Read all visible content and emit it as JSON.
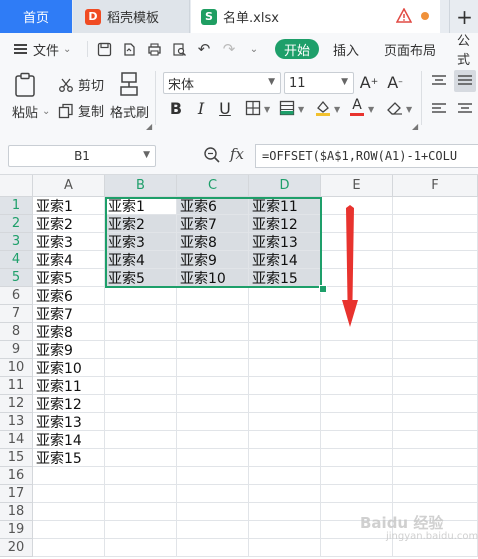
{
  "tabs": {
    "home": "首页",
    "docer": "稻壳模板",
    "docer_icon": "D",
    "file": "名单.xlsx",
    "file_icon": "S",
    "add": "+"
  },
  "menu": {
    "file_label": "文件",
    "start": "开始",
    "insert": "插入",
    "page_layout": "页面布局",
    "formula": "公式"
  },
  "ribbon": {
    "paste": "粘贴",
    "cut": "剪切",
    "copy": "复制",
    "format_painter": "格式刷",
    "font_name": "宋体",
    "font_size": "11",
    "bold": "B",
    "italic": "I",
    "underline": "U"
  },
  "formula_bar": {
    "name_box": "B1",
    "fx": "fx",
    "formula": "=OFFSET($A$1,ROW(A1)-1+COLU"
  },
  "columns": [
    "A",
    "B",
    "C",
    "D",
    "E",
    "F"
  ],
  "rows": [
    "1",
    "2",
    "3",
    "4",
    "5",
    "6",
    "7",
    "8",
    "9",
    "10",
    "11",
    "12",
    "13",
    "14",
    "15",
    "16",
    "17",
    "18",
    "19",
    "20"
  ],
  "cells": {
    "A": [
      "亚索1",
      "亚索2",
      "亚索3",
      "亚索4",
      "亚索5",
      "亚索6",
      "亚索7",
      "亚索8",
      "亚索9",
      "亚索10",
      "亚索11",
      "亚索12",
      "亚索13",
      "亚索14",
      "亚索15"
    ],
    "B": [
      "亚索1",
      "亚索2",
      "亚索3",
      "亚索4",
      "亚索5"
    ],
    "C": [
      "亚索6",
      "亚索7",
      "亚索8",
      "亚索9",
      "亚索10"
    ],
    "D": [
      "亚索11",
      "亚索12",
      "亚索13",
      "亚索14",
      "亚索15"
    ]
  },
  "watermark": "Baidu 经验",
  "watermark_sub": "jingyan.baidu.com",
  "colors": {
    "accent": "#1e9f6a",
    "home_tab": "#2f7cf6",
    "arrow": "#e8332e"
  }
}
